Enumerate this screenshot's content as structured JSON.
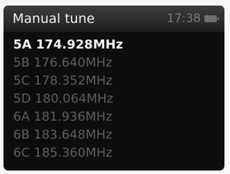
{
  "header": {
    "title": "Manual tune",
    "time": "17:38",
    "status_icon": "battery-icon"
  },
  "channels": [
    {
      "label": "5A 174.928MHz",
      "selected": true
    },
    {
      "label": "5B 176.640MHz",
      "selected": false
    },
    {
      "label": "5C 178.352MHz",
      "selected": false
    },
    {
      "label": "5D 180.064MHz",
      "selected": false
    },
    {
      "label": "6A 181.936MHz",
      "selected": false
    },
    {
      "label": "6B 183.648MHz",
      "selected": false
    },
    {
      "label": "6C 185.360MHz",
      "selected": false
    }
  ],
  "colors": {
    "selected_text": "#f2f2f2",
    "unselected_text": "#5e5e5e",
    "header_background": "#2e2e2e",
    "screen_background": "#0d0d0d"
  }
}
